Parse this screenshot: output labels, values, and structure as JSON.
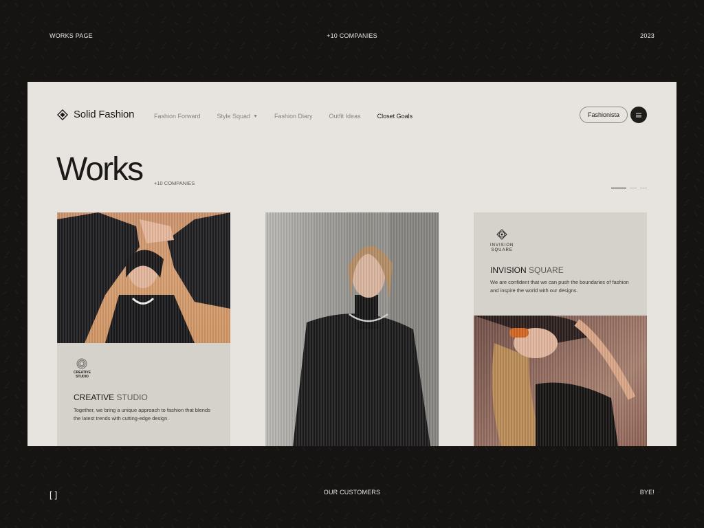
{
  "frame": {
    "top_left": "WORKS PAGE",
    "top_center": "+10 COMPANIES",
    "top_right": "2023",
    "bottom_left": "[ ]",
    "bottom_center": "OUR CUSTOMERS",
    "bottom_right": "BYE!"
  },
  "nav": {
    "logo_text": "Solid Fashion",
    "links": [
      "Fashion Forward",
      "Style Squad",
      "Fashion Diary",
      "Outfit Ideas",
      "Closet Goals"
    ],
    "cta_label": "Fashionista"
  },
  "hero": {
    "title": "Works",
    "subtitle": "+10 COMPANIES"
  },
  "cards": [
    {
      "logo_name": "CREATIVE\nSTUDIO",
      "heading_bold": "CREATIVE",
      "heading_light": "STUDIO",
      "description": "Together, we bring a unique approach to fashion that blends the latest trends with cutting-edge design."
    },
    {
      "logo_name": "INVISION\nSQUARE",
      "heading_bold": "INVISION",
      "heading_light": "SQUARE",
      "description": "We are confident that we can push the boundaries of fashion and inspire the world with our designs."
    }
  ],
  "colors": {
    "background": "#161413",
    "page": "#e7e3de",
    "card_info": "#d5d1cb",
    "ink": "#1b1a19"
  }
}
